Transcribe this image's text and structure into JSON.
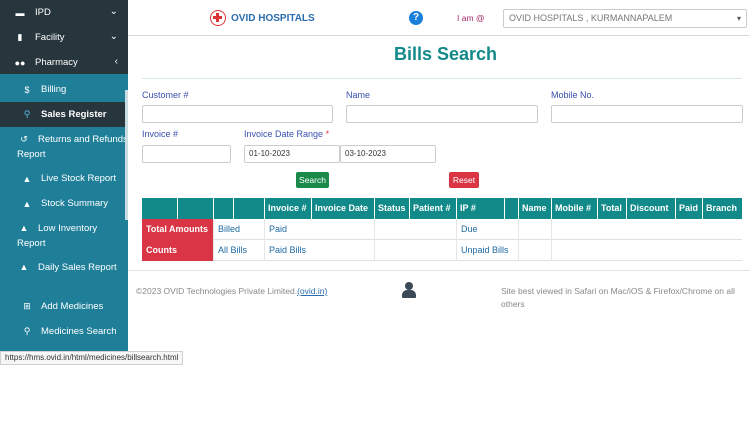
{
  "sidebar": {
    "items": [
      {
        "label": "IPD",
        "icon": "bed-icon",
        "chevron": "⌄"
      },
      {
        "label": "Facility",
        "icon": "building-icon",
        "chevron": "⌄"
      },
      {
        "label": "Pharmacy",
        "icon": "pills-icon",
        "chevron": "‹"
      }
    ],
    "sub_items": [
      {
        "label": "Billing",
        "icon": "dollar-icon"
      },
      {
        "label": "Sales Register",
        "icon": "search-icon"
      },
      {
        "label": "Returns and Refunds Report",
        "icon": "undo-icon"
      },
      {
        "label": "Live Stock Report",
        "icon": "cubes-icon"
      },
      {
        "label": "Stock Summary",
        "icon": "cubes-icon"
      },
      {
        "label": "Low Inventory Report",
        "icon": "cubes-icon"
      },
      {
        "label": "Daily Sales Report",
        "icon": "cubes-icon"
      },
      {
        "label": "Add Medicines",
        "icon": "plus-square-icon"
      },
      {
        "label": "Medicines Search",
        "icon": "search-icon"
      }
    ]
  },
  "header": {
    "brand": "OVID HOSPITALS",
    "help": "?",
    "iam_label": "I am @",
    "hospital_selected": "OVID HOSPITALS , KURMANNAPALEM"
  },
  "page": {
    "title": "Bills Search",
    "fields": {
      "customer_label": "Customer #",
      "name_label": "Name",
      "mobile_label": "Mobile No.",
      "invoice_label": "Invoice #",
      "range_label": "Invoice Date Range",
      "range_required": "*",
      "date_from": "01-10-2023",
      "date_to": "03-10-2023"
    },
    "buttons": {
      "search": "Search",
      "reset": "Reset"
    },
    "table": {
      "headers": [
        "",
        "",
        "",
        "",
        "Invoice #",
        "Invoice Date",
        "Status",
        "Patient #",
        "IP #",
        "",
        "Name",
        "Mobile #",
        "Total",
        "Discount",
        "Paid",
        "Branch"
      ],
      "rows": [
        {
          "label": "Total Amounts",
          "c1": "Billed",
          "c2": "Paid",
          "c3": "Due"
        },
        {
          "label": "Counts",
          "c1": "All Bills",
          "c2": "Paid Bills",
          "c3": "Unpaid Bills"
        }
      ]
    }
  },
  "footer": {
    "copyright": "©2023 OVID Technologies Private Limited.",
    "link": "(ovid.in)",
    "best_viewed": "Site best viewed in Safari on Mac/iOS & Firefox/Chrome on all others"
  },
  "statusbar": {
    "url": "https://hms.ovid.in/html/medicines/billsearch.html"
  }
}
